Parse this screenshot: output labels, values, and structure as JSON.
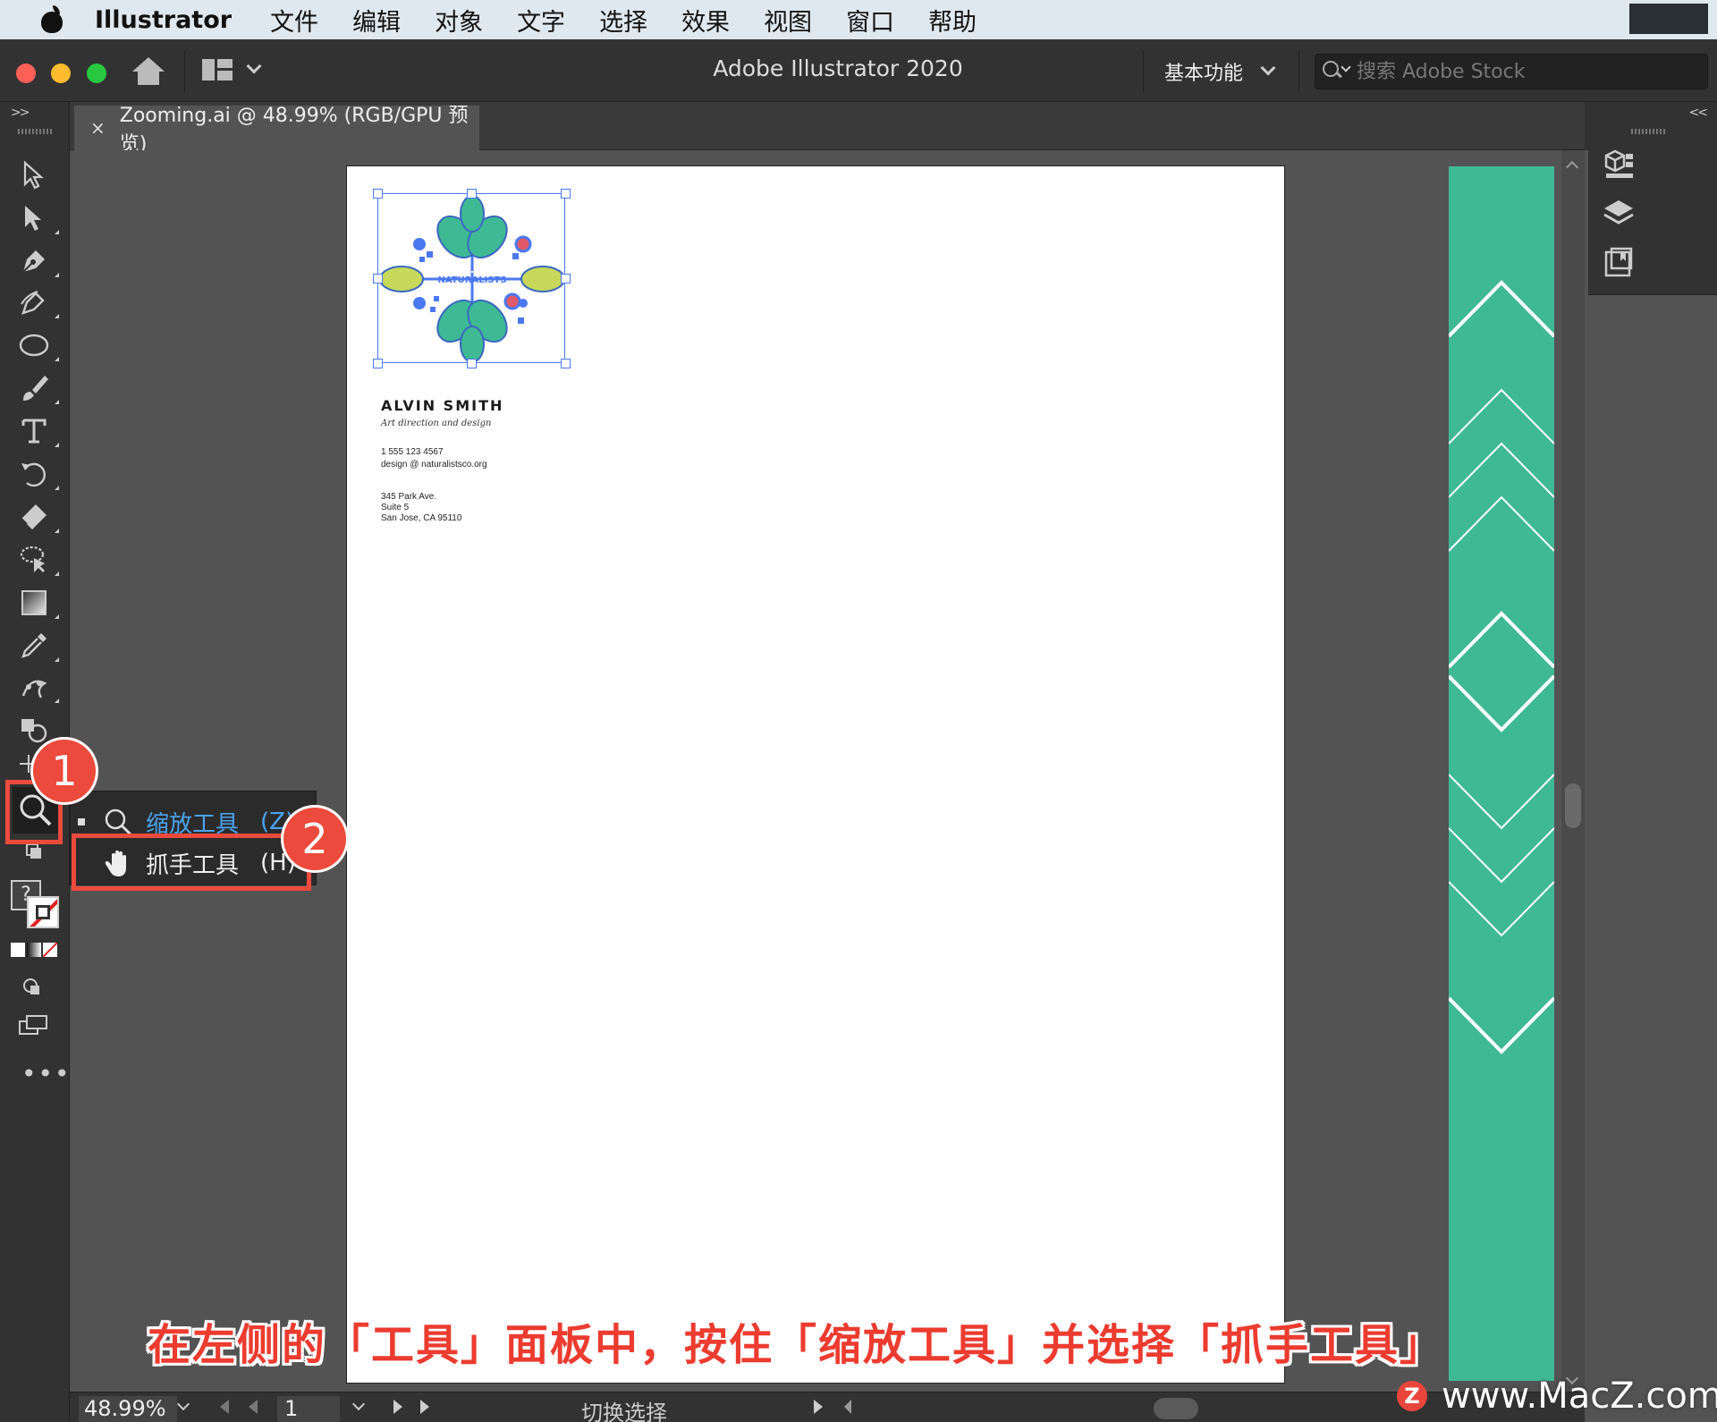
{
  "menubar": {
    "app_name": "Illustrator",
    "items": [
      "文件",
      "编辑",
      "对象",
      "文字",
      "选择",
      "效果",
      "视图",
      "窗口",
      "帮助"
    ]
  },
  "titlebar": {
    "app_title": "Adobe Illustrator 2020",
    "workspace": "基本功能",
    "search_placeholder": "搜索 Adobe Stock"
  },
  "toolbar": {
    "tools": [
      "selection-tool",
      "direct-selection-tool",
      "pen-tool",
      "curvature-tool",
      "ellipse-tool",
      "paintbrush-tool",
      "type-tool",
      "rotate-tool",
      "eraser-tool",
      "lasso-tool",
      "gradient-tool",
      "eyedropper-tool",
      "puppet-warp-tool",
      "shape-builder-tool",
      "artboard-tool",
      "zoom-tool"
    ],
    "fill_stroke_question": "?"
  },
  "document_tab": {
    "close": "×",
    "label": "Zooming.ai @ 48.99% (RGB/GPU 预览)"
  },
  "artboard": {
    "logo_text": "NATURALISTS",
    "name": "ALVIN SMITH",
    "tagline": "Art direction and design",
    "phone": "1 555 123 4567",
    "email": "design @ naturalistsco.org",
    "address1": "345 Park Ave.",
    "address2": "Suite 5",
    "address3": "San Jose, CA 95110"
  },
  "flyout": {
    "item1_label": "缩放工具",
    "item1_key": "(Z)",
    "item2_label": "抓手工具",
    "item2_key": "(H)"
  },
  "badges": {
    "one": "1",
    "two": "2"
  },
  "statusbar": {
    "zoom": "48.99%",
    "page": "1",
    "status": "切换选择"
  },
  "caption": "在左侧的「工具」面板中，按住「缩放工具」并选择「抓手工具」",
  "watermark": {
    "logo": "Z",
    "text": "www.MacZ.com"
  },
  "colors": {
    "accent_red": "#ec4a3c",
    "teal": "#3fb994",
    "link_blue": "#4aa3f0"
  }
}
